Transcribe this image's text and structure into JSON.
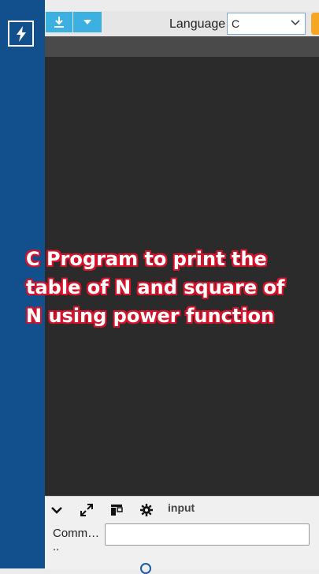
{
  "toolbar": {
    "language_label": "Language",
    "language_value": "C"
  },
  "overlay": {
    "title": "C Program to print the\ntable of N and square of\nN using power function"
  },
  "bottom_panel": {
    "input_tab_label": "input",
    "command_label": "Comm…\n..",
    "command_value": ""
  },
  "colors": {
    "sidebar": "#11508c",
    "toolbar_button": "#3cb0e0",
    "editor_bg": "#2b2b2b",
    "run_button": "#f5a623",
    "title_outline": "#d5132b"
  },
  "icons": [
    "bolt-icon",
    "download-icon",
    "caret-down-icon",
    "chevron-down-icon",
    "expand-icon",
    "layout-icon",
    "gear-icon"
  ]
}
